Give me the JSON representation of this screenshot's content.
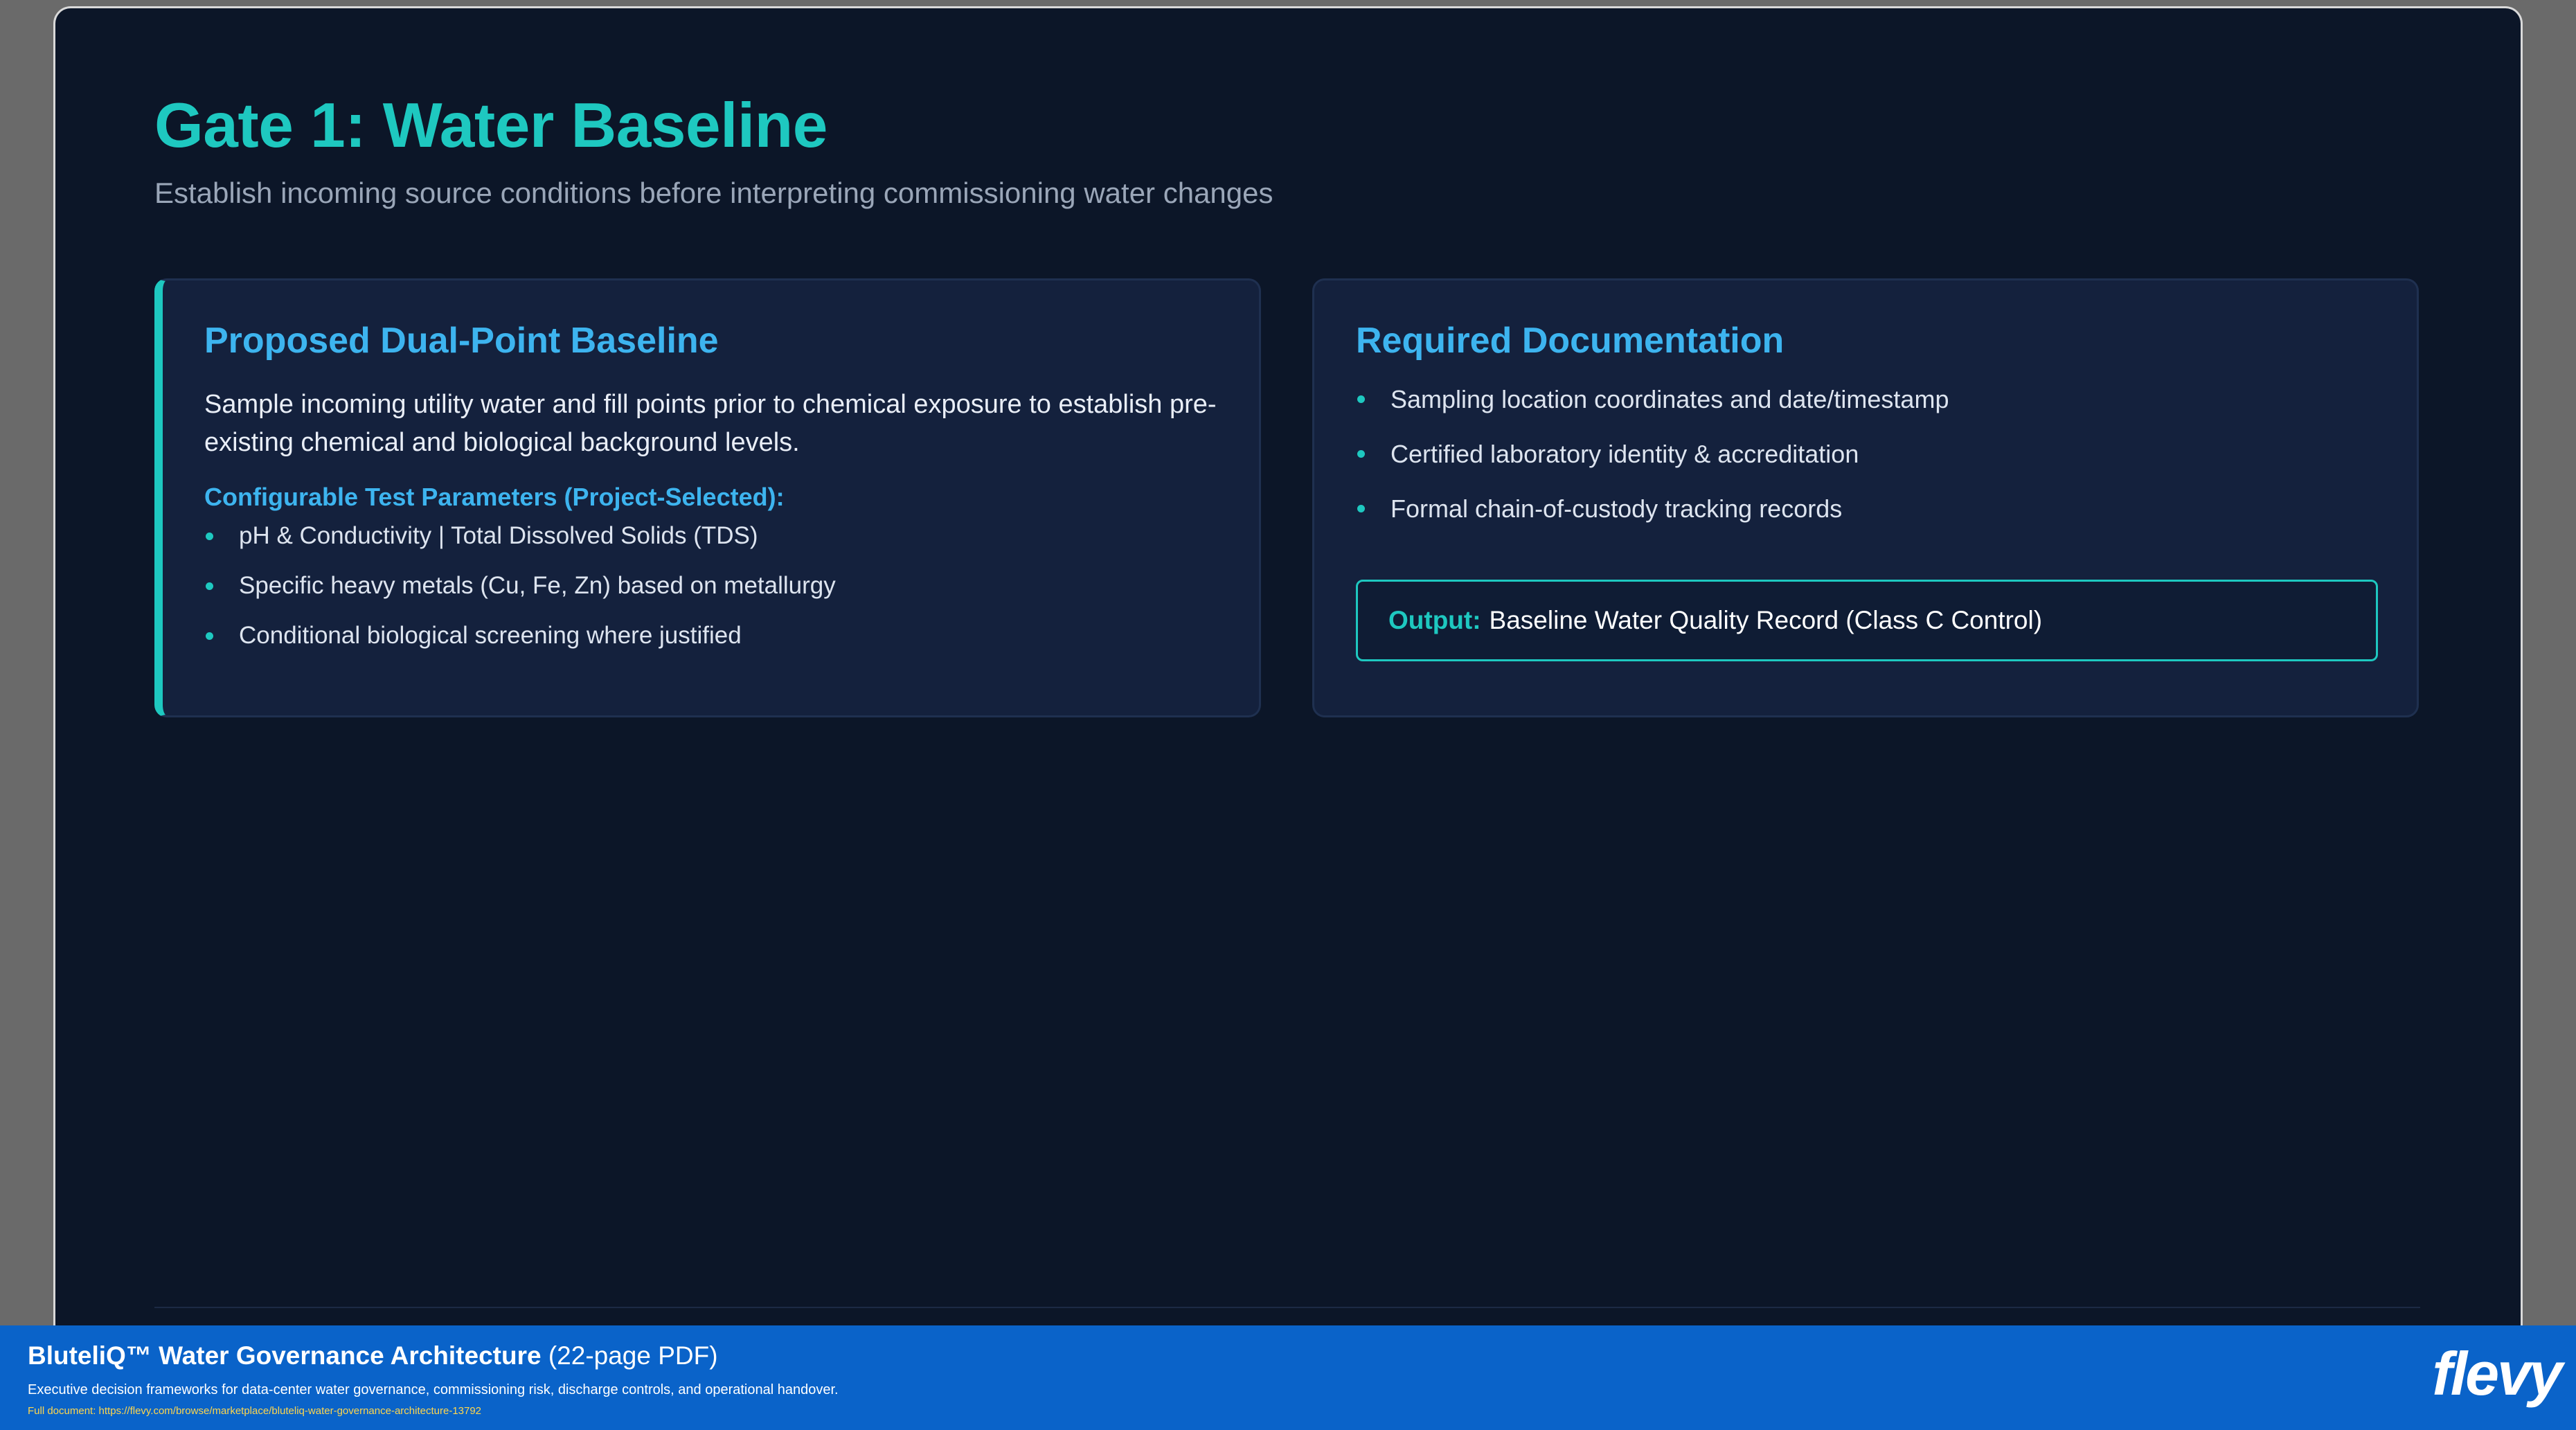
{
  "slide": {
    "title": "Gate 1: Water Baseline",
    "subtitle": "Establish incoming source conditions before interpreting commissioning water changes"
  },
  "left_card": {
    "heading": "Proposed Dual-Point Baseline",
    "description": "Sample incoming utility water and fill points prior to chemical exposure to establish pre-existing chemical and biological background levels.",
    "params_heading": "Configurable Test Parameters (Project-Selected):",
    "items": [
      "pH & Conductivity | Total Dissolved Solids (TDS)",
      "Specific heavy metals (Cu, Fe, Zn) based on metallurgy",
      "Conditional biological screening where justified"
    ]
  },
  "right_card": {
    "heading": "Required Documentation",
    "items": [
      "Sampling location coordinates and date/timestamp",
      "Certified laboratory identity & accreditation",
      "Formal chain-of-custody tracking records"
    ],
    "output_label": "Output:",
    "output_value": "Baseline Water Quality Record (Class C Control)"
  },
  "banner": {
    "title": "BluteliQ™ Water Governance Architecture",
    "pages": "(22-page PDF)",
    "description": "Executive decision frameworks for data-center water governance, commissioning risk, discharge controls, and operational handover.",
    "link": "Full document: https://flevy.com/browse/marketplace/bluteliq-water-governance-architecture-13792",
    "logo": "flevy"
  },
  "colors": {
    "accent_teal": "#1ec8c0",
    "heading_blue": "#3db4ef",
    "slide_background": "#0c1628",
    "card_background": "#14213d",
    "banner_blue": "#0a63c9"
  }
}
